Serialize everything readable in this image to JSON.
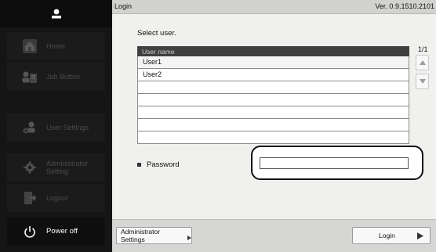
{
  "sidebar": {
    "user_icon": "person-icon",
    "items": [
      {
        "name": "home",
        "label": "Home",
        "icon": "home-icon"
      },
      {
        "name": "job-button",
        "label": "Job Button",
        "icon": "job-button-icon"
      },
      {
        "name": "user-settings",
        "label": "User Settings",
        "icon": "user-settings-icon"
      },
      {
        "name": "administrator-setting",
        "label": "Administrator Setting",
        "icon": "gear-icon"
      },
      {
        "name": "logout",
        "label": "Logout",
        "icon": "logout-icon"
      },
      {
        "name": "power-off",
        "label": "Power off",
        "icon": "power-icon"
      }
    ]
  },
  "titlebar": {
    "title": "Login",
    "version": "Ver. 0.9.1510.2101"
  },
  "main": {
    "prompt": "Select user.",
    "table": {
      "header": "User name",
      "rows": [
        "User1",
        "User2",
        "",
        "",
        "",
        "",
        ""
      ]
    },
    "page_indicator": "1/1",
    "password_label": "Password",
    "password_value": ""
  },
  "footer": {
    "admin_button": "Administrator Settings",
    "login_button": "Login"
  },
  "colors": {
    "sidebar_bg": "#151515",
    "main_bg": "#f0f0ee",
    "header_bg": "#3f3f3f"
  }
}
